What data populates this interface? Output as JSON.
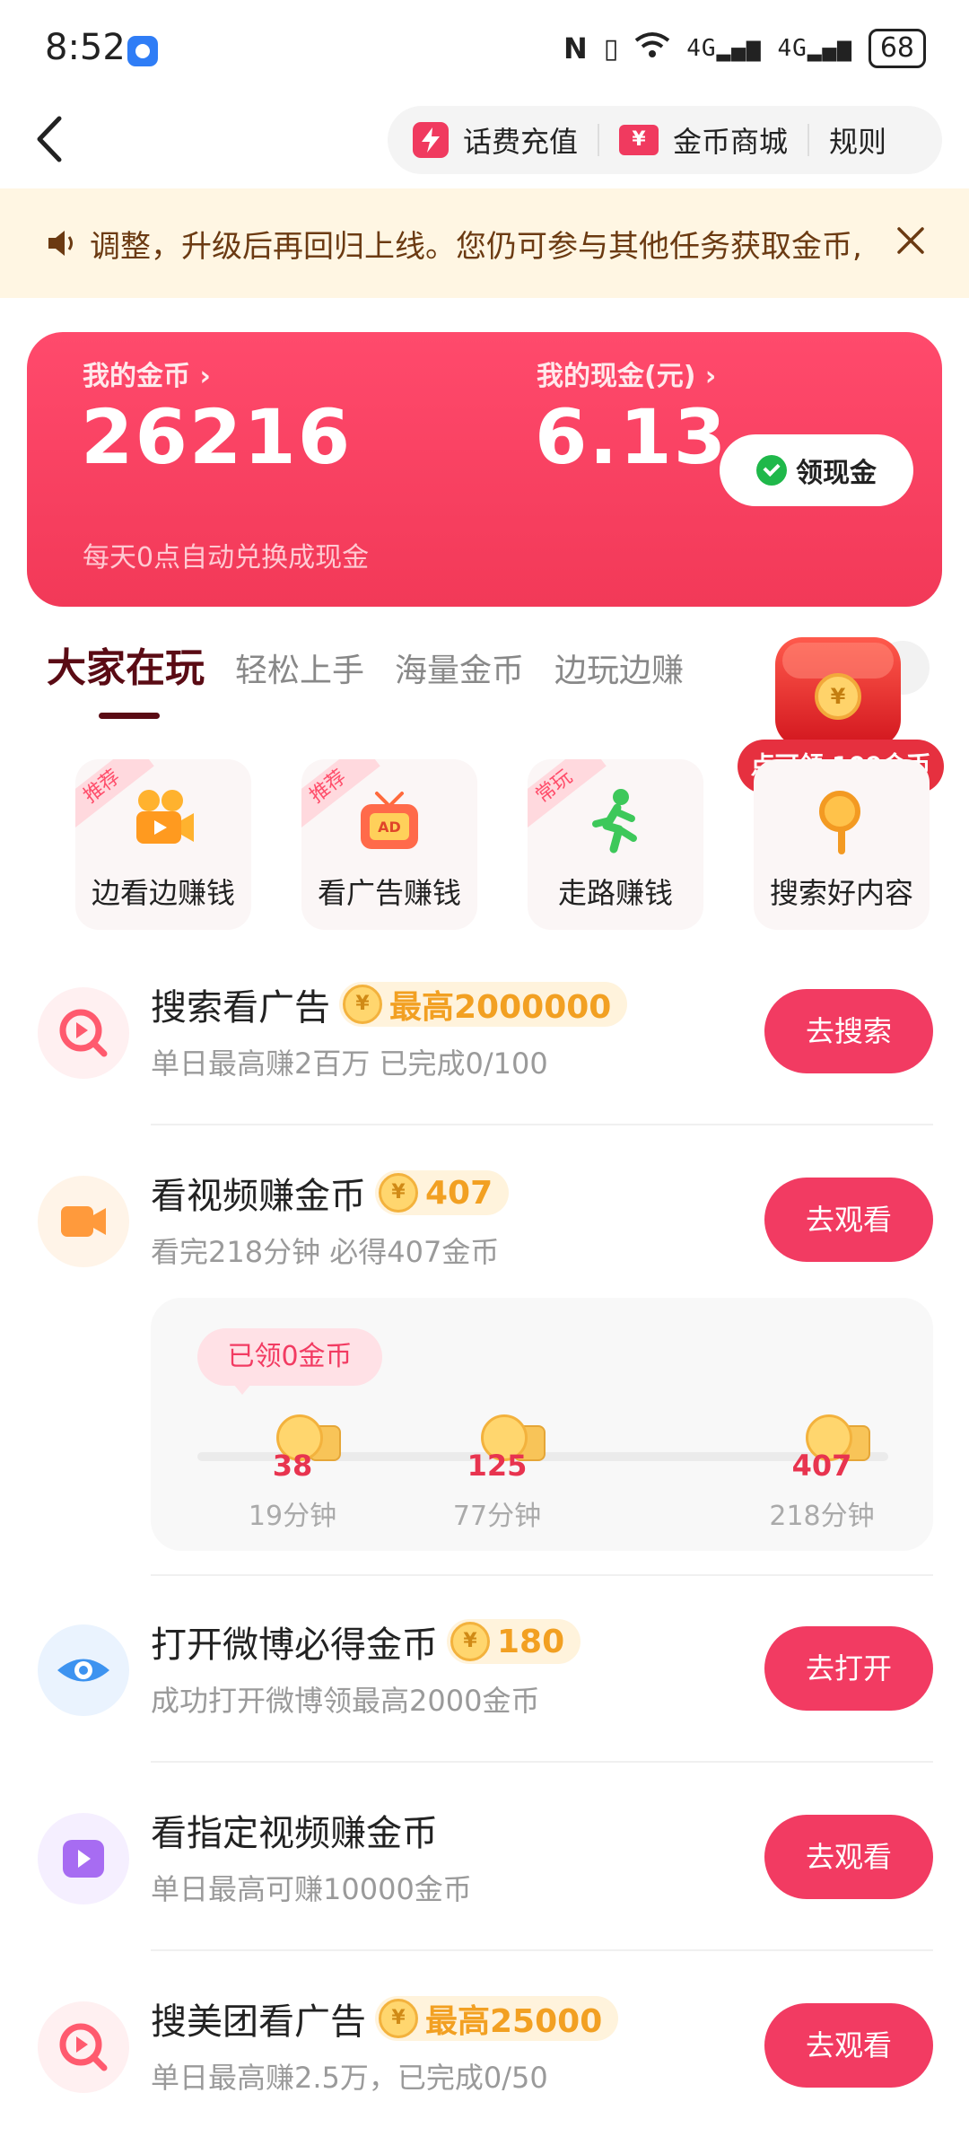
{
  "status_bar": {
    "time": "8:52",
    "nfc": "N",
    "network_1": "4G",
    "network_2": "4G",
    "battery": "68"
  },
  "header": {
    "links": [
      {
        "label": "话费充值",
        "icon": "lightning-icon"
      },
      {
        "label": "金币商城",
        "icon": "ticket-icon"
      },
      {
        "label": "规则"
      }
    ]
  },
  "notice": {
    "text": "调整，升级后再回归上线。您仍可参与其他任务获取金币,"
  },
  "wallet": {
    "coins_label": "我的金币",
    "coins_value": "26216",
    "cash_label": "我的现金(元)",
    "cash_value": "6.13",
    "withdraw_label": "领现金",
    "note": "每天0点自动兑换成现金"
  },
  "tabs": [
    "大家在玩",
    "轻松上手",
    "海量金币",
    "边玩边赚"
  ],
  "chest": {
    "label": "点可领 109金币"
  },
  "quick_entries": [
    {
      "tag": "推荐",
      "label": "边看边赚钱",
      "icon": "video-camera-icon"
    },
    {
      "tag": "推荐",
      "label": "看广告赚钱",
      "icon": "tv-ad-icon"
    },
    {
      "tag": "常玩",
      "label": "走路赚钱",
      "icon": "running-person-icon"
    },
    {
      "tag": "",
      "label": "搜索好内容",
      "icon": "magnifier-icon"
    }
  ],
  "tasks": [
    {
      "title": "搜索看广告",
      "reward": "最高2000000",
      "subtitle": "单日最高赚2百万 已完成0/100",
      "button": "去搜索",
      "icon": "search-play-icon",
      "color": "#ff5a6e"
    },
    {
      "title": "看视频赚金币",
      "reward": "407",
      "subtitle": "看完218分钟 必得407金币",
      "button": "去观看",
      "icon": "video-icon",
      "color": "#ff9a3c"
    },
    {
      "title": "打开微博必得金币",
      "reward": "180",
      "subtitle": "成功打开微博领最高2000金币",
      "button": "去打开",
      "icon": "eye-icon",
      "color": "#3d93f0"
    },
    {
      "title": "看指定视频赚金币",
      "reward": "",
      "subtitle": "单日最高可赚10000金币",
      "button": "去观看",
      "icon": "play-icon",
      "color": "#a76cf2"
    },
    {
      "title": "搜美团看广告",
      "reward": "最高25000",
      "subtitle": "单日最高赚2.5万，已完成0/50",
      "button": "去观看",
      "icon": "search-play-icon",
      "color": "#ff5a6e"
    }
  ],
  "video_progress": {
    "collected": "已领0金币",
    "progress": 0,
    "milestones": [
      {
        "coins": "38",
        "time": "19分钟"
      },
      {
        "coins": "125",
        "time": "77分钟"
      },
      {
        "coins": "407",
        "time": "218分钟"
      }
    ]
  }
}
